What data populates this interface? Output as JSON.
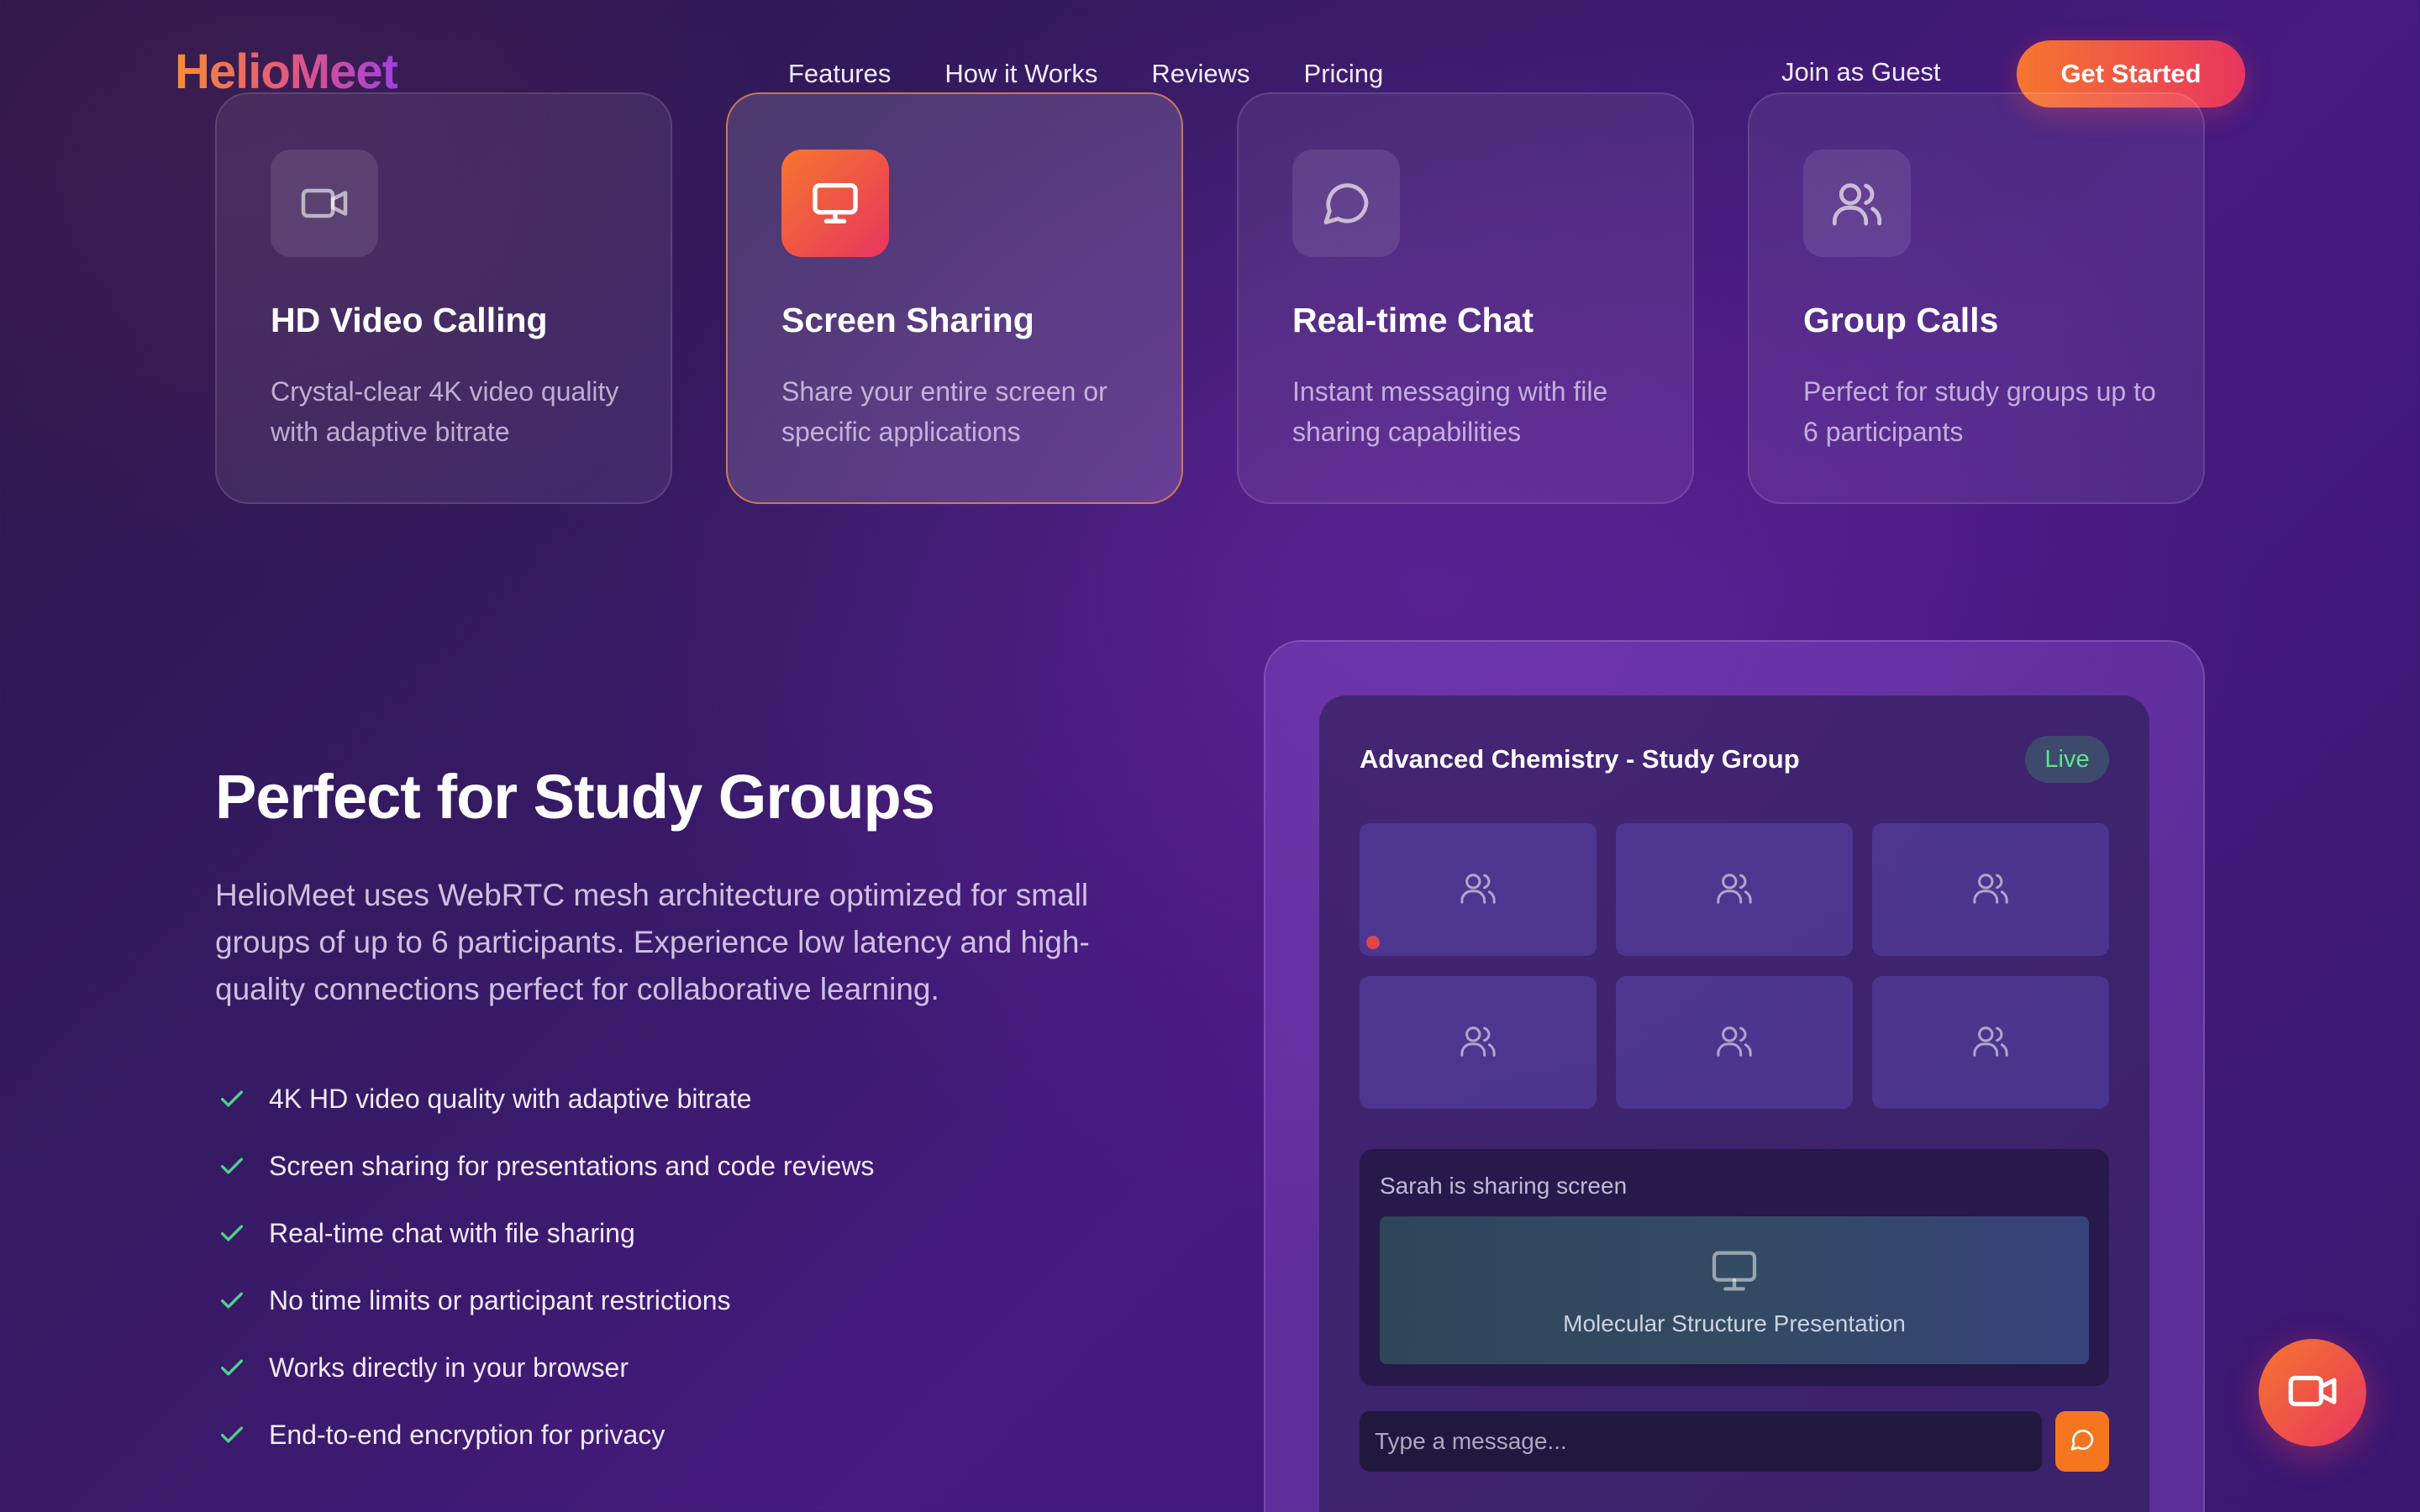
{
  "nav": {
    "logo": "HelioMeet",
    "links": [
      "Features",
      "How it Works",
      "Reviews",
      "Pricing"
    ],
    "guest_label": "Join as Guest",
    "cta_label": "Get Started"
  },
  "features": [
    {
      "icon": "video-camera-icon",
      "title": "HD Video Calling",
      "desc": "Crystal-clear 4K video quality with adaptive bitrate",
      "active": false
    },
    {
      "icon": "monitor-icon",
      "title": "Screen Sharing",
      "desc": "Share your entire screen or specific applications",
      "active": true
    },
    {
      "icon": "chat-bubble-icon",
      "title": "Real-time Chat",
      "desc": "Instant messaging with file sharing capabilities",
      "active": false
    },
    {
      "icon": "users-icon",
      "title": "Group Calls",
      "desc": "Perfect for study groups up to 6 participants",
      "active": false
    }
  ],
  "study": {
    "title": "Perfect for Study Groups",
    "desc": "HelioMeet uses WebRTC mesh architecture optimized for small groups of up to 6 participants. Experience low latency and high-quality connections perfect for collaborative learning.",
    "checks": [
      "4K HD video quality with adaptive bitrate",
      "Screen sharing for presentations and code reviews",
      "Real-time chat with file sharing",
      "No time limits or participant restrictions",
      "Works directly in your browser",
      "End-to-end encryption for privacy"
    ]
  },
  "mock": {
    "room_title": "Advanced Chemistry - Study Group",
    "status": "Live",
    "share_label": "Sarah is sharing screen",
    "share_caption": "Molecular Structure Presentation",
    "message_placeholder": "Type a message..."
  },
  "colors": {
    "accent_orange": "#f5762e",
    "accent_pink": "#e8355f",
    "live_green": "#5ee38f",
    "check_green": "#4fd18a"
  }
}
